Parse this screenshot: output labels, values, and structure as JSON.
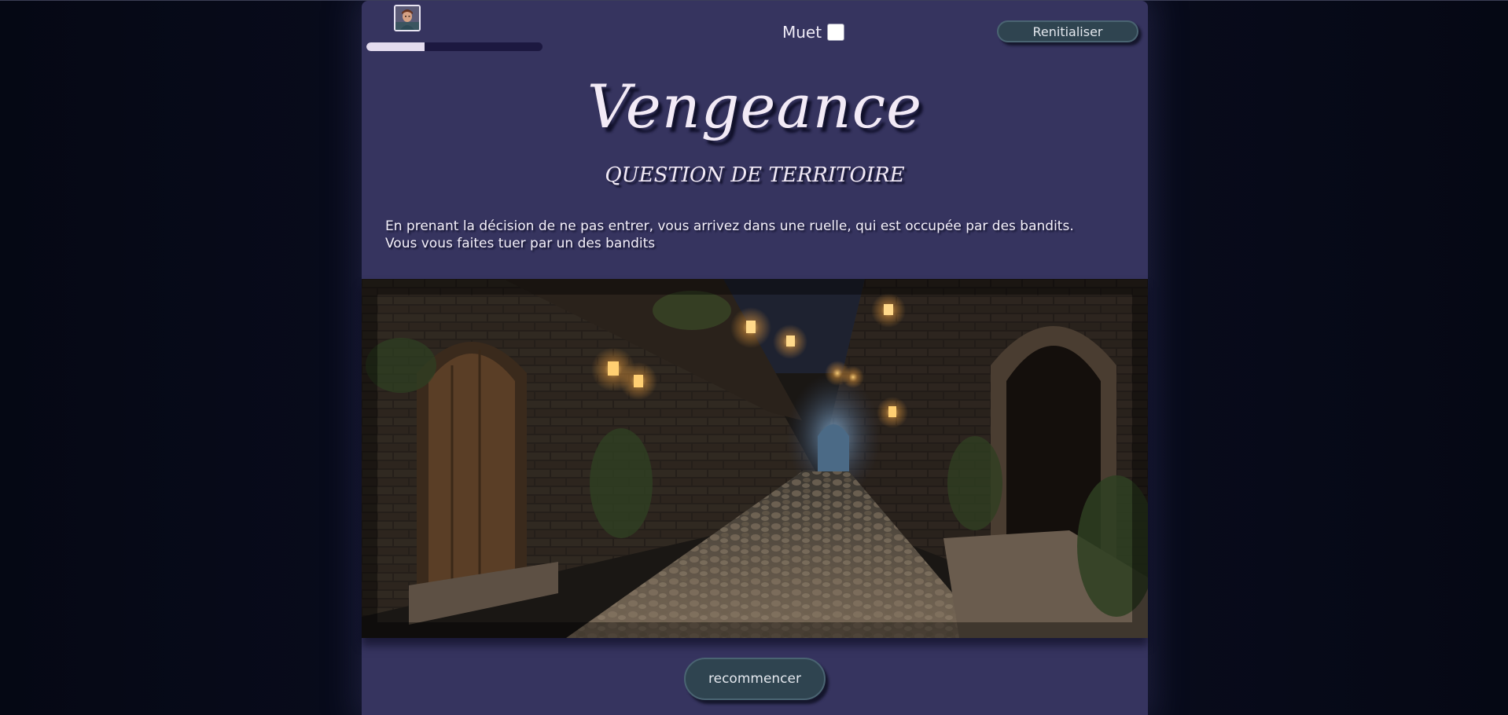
{
  "header": {
    "avatar_icon": "character-portrait-icon",
    "progress": 0.33,
    "mute_label": "Muet",
    "mute_checked": false,
    "reset_label": "Renitialiser"
  },
  "story": {
    "title": "Vengeance",
    "subtitle": "QUESTION DE TERRITOIRE",
    "line1": "En prenant la décision de ne pas entrer, vous arrivez dans une ruelle, qui est occupée par des bandits.",
    "line2": "Vous vous faites tuer par un des bandits"
  },
  "scene": {
    "image": "medieval-alley-night-illustration"
  },
  "actions": {
    "restart_label": "recommencer"
  },
  "colors": {
    "page_bg": "#030611",
    "panel_bg": "#36345f",
    "button_bg": "#2f4450",
    "text": "#f2eaf6"
  }
}
